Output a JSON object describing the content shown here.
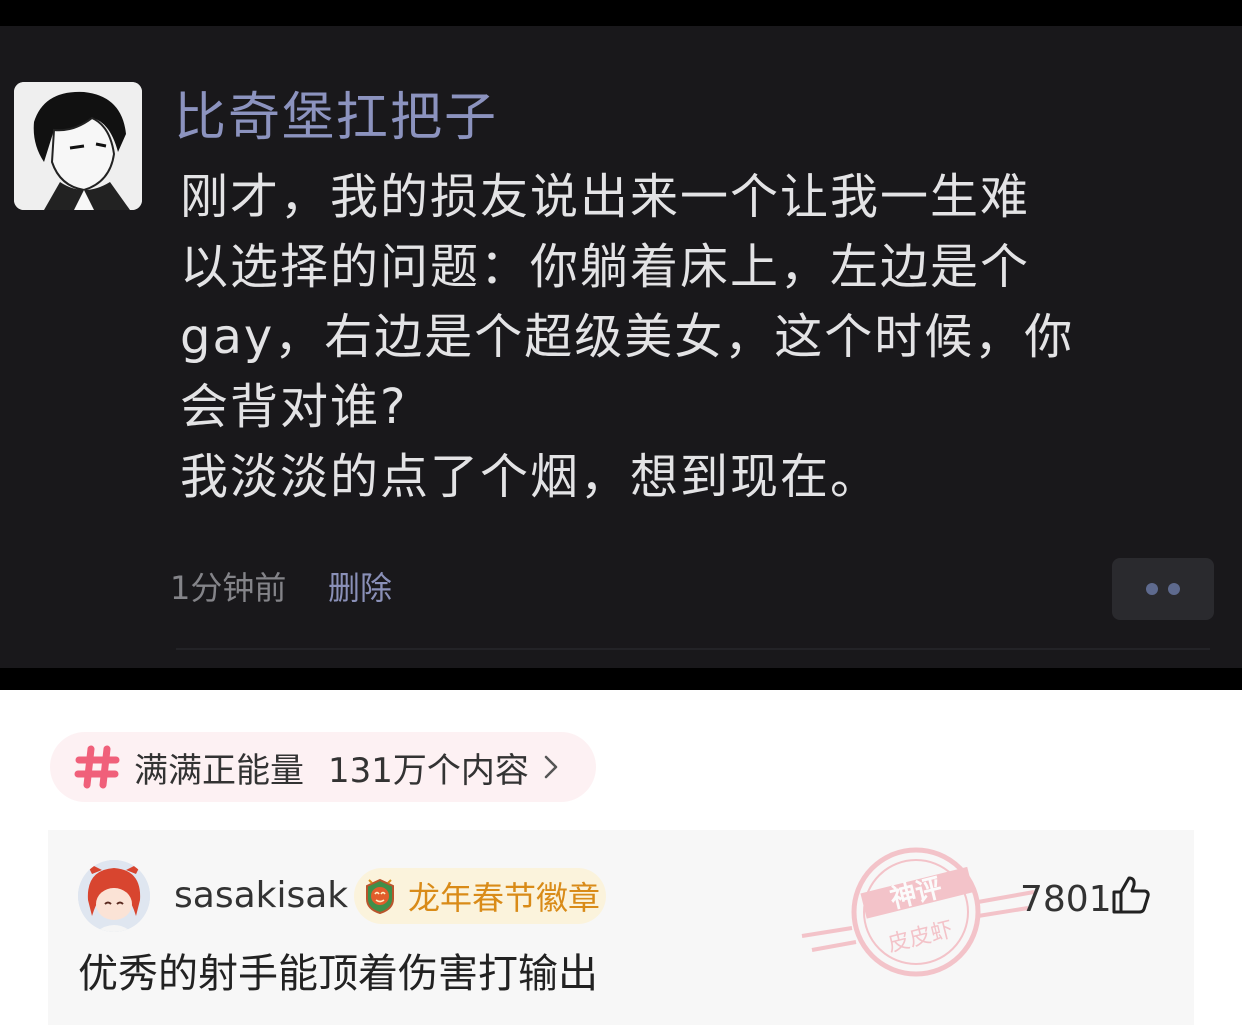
{
  "post": {
    "username": "比奇堡扛把子",
    "lines": [
      "刚才，我的损友说出来一个让我一生难",
      "以选择的问题：你躺着床上，左边是个",
      "gay，右边是个超级美女，这个时候，你",
      "会背对谁?",
      "我淡淡的点了个烟，想到现在。"
    ],
    "time": "1分钟前",
    "delete_label": "删除",
    "more_icon": "more-dots-icon"
  },
  "topic": {
    "icon": "hashtag-icon",
    "name": "满满正能量",
    "count": "131万个内容",
    "arrow_icon": "chevron-right-icon",
    "hash_color": "#f0607a"
  },
  "comment": {
    "username": "sasakisak",
    "badge_icon": "dragon-badge-icon",
    "badge_label": "龙年春节徽章",
    "badge_color": "#d98b18",
    "text": "优秀的射手能顶着伤害打输出",
    "stamp_text_top": "神评",
    "stamp_text_bottom": "皮皮虾",
    "stamp_color": "#f19aa4",
    "likes": "7801",
    "like_icon": "thumbs-up-icon"
  }
}
